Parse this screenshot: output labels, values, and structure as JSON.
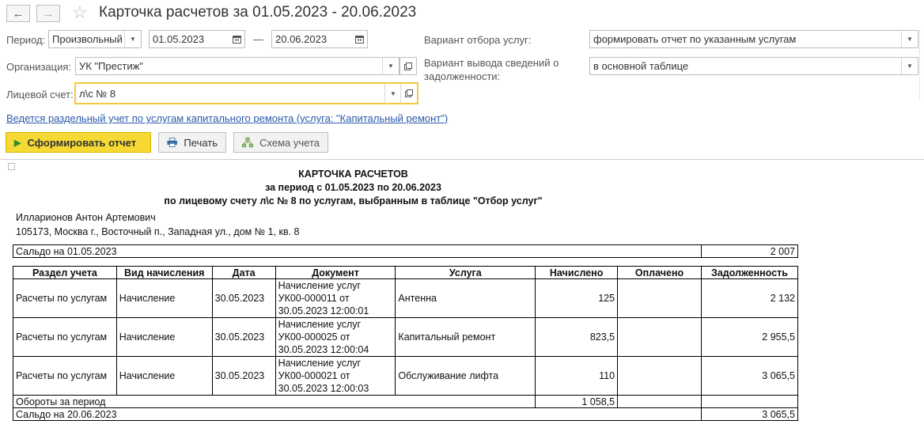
{
  "window": {
    "title": "Карточка расчетов  за 01.05.2023 - 20.06.2023"
  },
  "filters": {
    "period_label": "Период:",
    "period_type": "Произвольный",
    "date_from": "01.05.2023",
    "dash": "—",
    "date_to": "20.06.2023",
    "org_label": "Организация:",
    "org_value": "УК \"Престиж\"",
    "account_label": "Лицевой счет:",
    "account_value": "л\\с № 8",
    "service_filter_label": "Вариант отбора услуг:",
    "service_filter_value": "формировать отчет по указанным услугам",
    "debt_output_label_1": "Вариант вывода сведений о",
    "debt_output_label_2": "задолженности:",
    "debt_output_value": "в основной таблице"
  },
  "info_link": "Ведется раздельный учет по услугам капитального ремонта (услуга: \"Капитальный ремонт\")",
  "toolbar": {
    "generate_label": "Сформировать отчет",
    "print_label": "Печать",
    "scheme_label": "Схема учета"
  },
  "report": {
    "title": "КАРТОЧКА РАСЧЕТОВ",
    "period_line": "за период с 01.05.2023 по 20.06.2023",
    "account_line": "по лицевому счету л\\с № 8 по услугам, выбранным в таблице \"Отбор услуг\"",
    "person": "Илларионов Антон Артемович",
    "address": "105173, Москва г., Восточный п., Западная ул., дом № 1, кв. 8",
    "opening_label": "Сальдо на 01.05.2023",
    "opening_value": "2 007",
    "columns": [
      "Раздел учета",
      "Вид начисления",
      "Дата",
      "Документ",
      "Услуга",
      "Начислено",
      "Оплачено",
      "Задолженность"
    ],
    "rows": [
      {
        "section": "Расчеты по услугам",
        "kind": "Начисление",
        "date": "30.05.2023",
        "doc1": "Начисление услуг",
        "doc2": "УК00-000011 от",
        "doc3": "30.05.2023 12:00:01",
        "service": "Антенна",
        "charged": "125",
        "paid": "",
        "debt": "2 132"
      },
      {
        "section": "Расчеты по услугам",
        "kind": "Начисление",
        "date": "30.05.2023",
        "doc1": "Начисление услуг",
        "doc2": "УК00-000025 от",
        "doc3": "30.05.2023 12:00:04",
        "service": "Капитальный ремонт",
        "charged": "823,5",
        "paid": "",
        "debt": "2 955,5"
      },
      {
        "section": "Расчеты по услугам",
        "kind": "Начисление",
        "date": "30.05.2023",
        "doc1": "Начисление услуг",
        "doc2": "УК00-000021 от",
        "doc3": "30.05.2023 12:00:03",
        "service": "Обслуживание лифта",
        "charged": "110",
        "paid": "",
        "debt": "3 065,5"
      }
    ],
    "turnover_label": "Обороты за период",
    "turnover_charged": "1 058,5",
    "closing_label": "Сальдо на 20.06.2023",
    "closing_value": "3 065,5"
  }
}
